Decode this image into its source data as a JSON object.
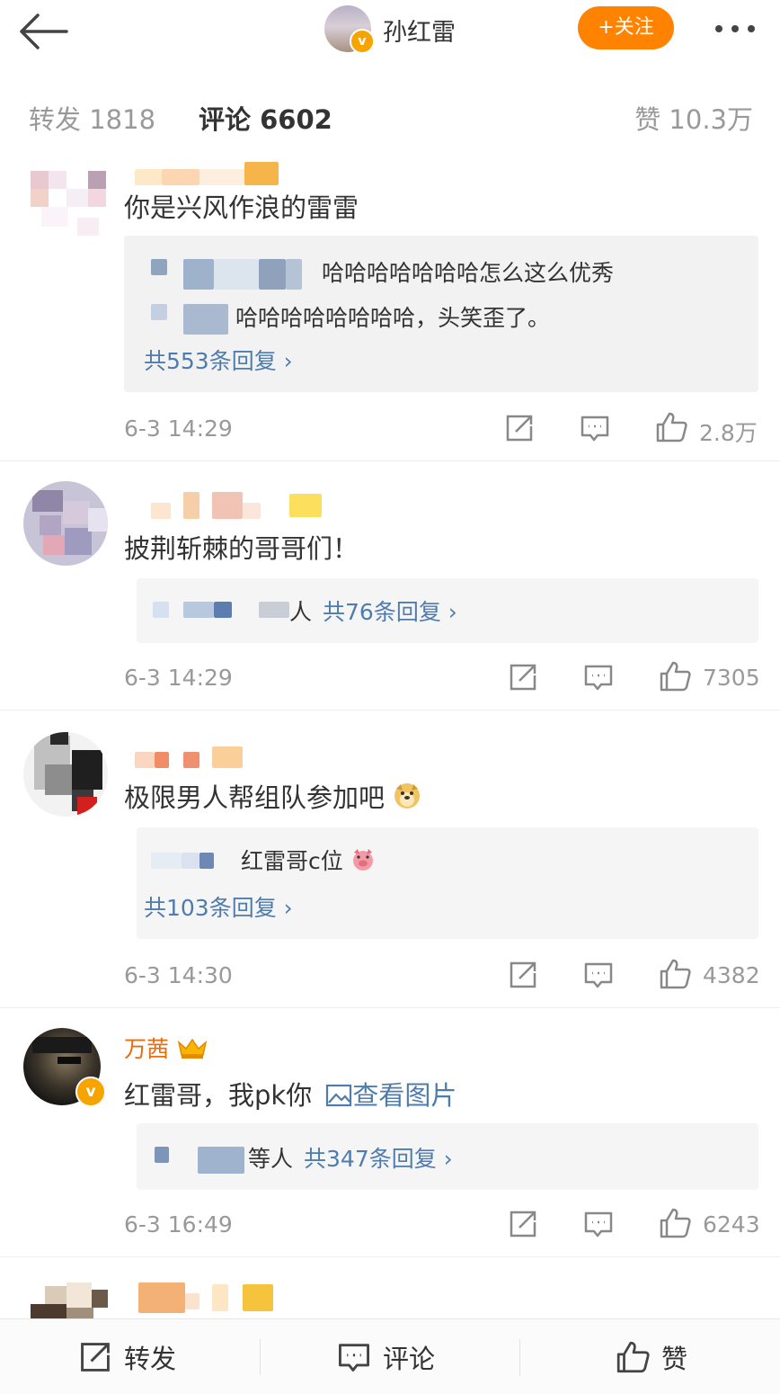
{
  "header": {
    "title": "孙红雷",
    "follow_label": "+关注",
    "verified_mark": "v",
    "icons": [
      "back-arrow-icon",
      "more-dots-icon"
    ]
  },
  "tabs": {
    "repost": "转发 1818",
    "comment": "评论 6602",
    "like": "赞 10.3万"
  },
  "comments": [
    {
      "text": "你是兴风作浪的雷雷",
      "replies": [
        "哈哈哈哈哈哈哈怎么这么优秀",
        "哈哈哈哈哈哈哈哈，头笑歪了。"
      ],
      "reply_total": "共553条回复",
      "time": "6-3 14:29",
      "likes": "2.8万"
    },
    {
      "text": "披荆斩棘的哥哥们！",
      "reply_suffix": "人",
      "reply_total": "共76条回复",
      "time": "6-3 14:29",
      "likes": "7305"
    },
    {
      "text": "极限男人帮组队参加吧",
      "replies": [
        "红雷哥c位"
      ],
      "reply_total": "共103条回复",
      "time": "6-3 14:30",
      "likes": "4382"
    },
    {
      "username": "万茜",
      "text": "红雷哥，我pk你",
      "image_link": "查看图片",
      "reply_suffix": "等人",
      "reply_total": "共347条回复",
      "time": "6-3 16:49",
      "likes": "6243"
    }
  ],
  "bottombar": {
    "repost": "转发",
    "comment": "评论",
    "like": "赞"
  },
  "colors": {
    "accent_orange": "#ff8200",
    "link_blue": "#4f7cae",
    "username_orange": "#e86b0f",
    "muted_gray": "#999999"
  }
}
